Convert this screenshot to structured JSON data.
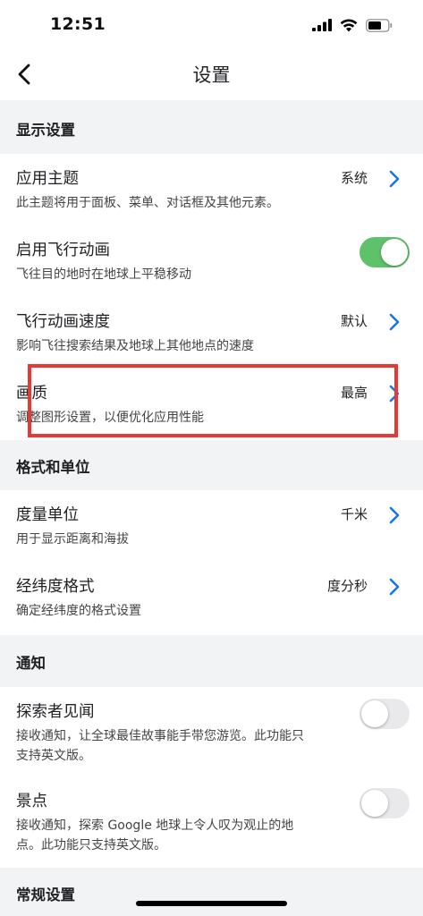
{
  "status": {
    "time": "12:51"
  },
  "header": {
    "title": "设置"
  },
  "colors": {
    "accent": "#1a73e8",
    "toggle_on": "#5fc16a",
    "section_bg": "#f1f3f4",
    "highlight": "#e53935"
  },
  "sections": {
    "display": {
      "title": "显示设置",
      "theme": {
        "title": "应用主题",
        "subtitle": "此主题将用于面板、菜单、对话框及其他元素。",
        "value": "系统"
      },
      "flight_anim": {
        "title": "启用飞行动画",
        "subtitle": "飞往目的地时在地球上平稳移动",
        "enabled": true
      },
      "flight_speed": {
        "title": "飞行动画速度",
        "subtitle": "影响飞往搜索结果及地球上其他地点的速度",
        "value": "默认"
      },
      "quality": {
        "title": "画质",
        "subtitle": "调整图形设置，以便优化应用性能",
        "value": "最高"
      }
    },
    "format": {
      "title": "格式和单位",
      "units": {
        "title": "度量单位",
        "subtitle": "用于显示距离和海拔",
        "value": "千米"
      },
      "latlng": {
        "title": "经纬度格式",
        "subtitle": "确定经纬度的格式设置",
        "value": "度分秒"
      }
    },
    "notify": {
      "title": "通知",
      "explorer": {
        "title": "探索者见闻",
        "subtitle1": "接收通知，让全球最佳故事能手带您游览。此功能只",
        "subtitle2": "支持英文版。",
        "enabled": false
      },
      "spots": {
        "title": "景点",
        "subtitle1": "接收通知，探索 Google 地球上令人叹为观止的地",
        "subtitle2": "点。此功能只支持英文版。",
        "enabled": false
      }
    },
    "general": {
      "title": "常规设置"
    }
  }
}
